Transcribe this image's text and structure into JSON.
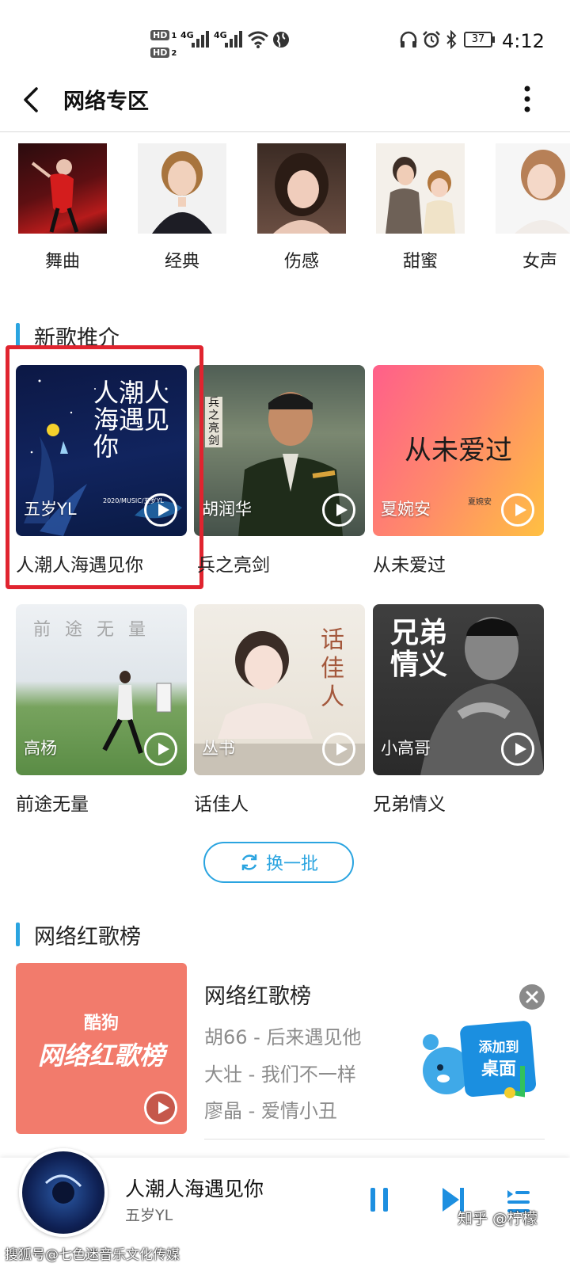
{
  "status_bar": {
    "hd1": "HD",
    "hd1_sub": "1",
    "hd2": "HD",
    "hd2_sub": "2",
    "net1": "4G",
    "net2": "4G",
    "battery": "37",
    "time": "4:12"
  },
  "header": {
    "title": "网络专区",
    "back_icon": "back-arrow-icon",
    "more_icon": "more-vertical-icon"
  },
  "categories": [
    {
      "label": "舞曲"
    },
    {
      "label": "经典"
    },
    {
      "label": "伤感"
    },
    {
      "label": "甜蜜"
    },
    {
      "label": "女声"
    }
  ],
  "new_songs": {
    "title": "新歌推介",
    "items": [
      {
        "artist": "五岁YL",
        "title": "人潮人海遇见你",
        "cover_text": "人潮人海遇见你",
        "cover_sub": "2020/MUSIC/五岁YL",
        "highlighted": true
      },
      {
        "artist": "胡润华",
        "title": "兵之亮剑",
        "cover_text": "兵之亮剑"
      },
      {
        "artist": "夏婉安",
        "title": "从未爱过",
        "cover_text": "从未爱过",
        "cover_sub": "夏婉安"
      },
      {
        "artist": "高杨",
        "title": "前途无量",
        "cover_text": "前途无量"
      },
      {
        "artist": "丛书",
        "title": "话佳人",
        "cover_text": "话佳人"
      },
      {
        "artist": "小高哥",
        "title": "兄弟情义",
        "cover_text": "兄弟情义"
      }
    ],
    "refresh_label": "换一批"
  },
  "hot_chart": {
    "section_title": "网络红歌榜",
    "cover_brand": "酷狗",
    "cover_title": "网络红歌榜",
    "title": "网络红歌榜",
    "lines": [
      "胡66 - 后来遇见他",
      "大壮 - 我们不一样",
      "廖晶 - 爱情小丑"
    ],
    "promo_line1": "添加到",
    "promo_line2": "桌面"
  },
  "player": {
    "title": "人潮人海遇见你",
    "artist": "五岁YL"
  },
  "watermarks": {
    "left": "搜狐号@七色迷音乐文化传媒",
    "right": "知乎 @柠檬"
  },
  "colors": {
    "accent": "#2aa4e0",
    "highlight_border": "#e0242f",
    "chart_cover": "#f27b6c"
  }
}
